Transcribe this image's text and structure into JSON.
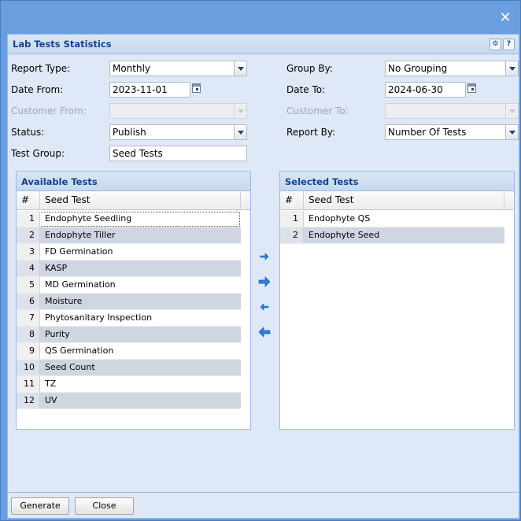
{
  "window": {
    "close_symbol": "✕"
  },
  "dialog": {
    "title": "Lab Tests Statistics",
    "tools": {
      "gear_symbol": "⚙",
      "help_symbol": "?"
    }
  },
  "form": {
    "report_type": {
      "label": "Report Type:",
      "value": "Monthly"
    },
    "group_by": {
      "label": "Group By:",
      "value": "No Grouping"
    },
    "date_from": {
      "label": "Date From:",
      "value": "2023-11-01"
    },
    "date_to": {
      "label": "Date To:",
      "value": "2024-06-30"
    },
    "customer_from": {
      "label": "Customer From:",
      "value": ""
    },
    "customer_to": {
      "label": "Customer To:",
      "value": ""
    },
    "status": {
      "label": "Status:",
      "value": "Publish"
    },
    "report_by": {
      "label": "Report By:",
      "value": "Number Of Tests"
    },
    "test_group": {
      "label": "Test Group:",
      "value": "Seed Tests"
    }
  },
  "available_tests": {
    "title": "Available Tests",
    "columns": [
      "#",
      "Seed Test"
    ],
    "rows": [
      {
        "n": "1",
        "name": "Endophyte Seedling"
      },
      {
        "n": "2",
        "name": "Endophyte Tiller"
      },
      {
        "n": "3",
        "name": "FD Germination"
      },
      {
        "n": "4",
        "name": "KASP"
      },
      {
        "n": "5",
        "name": "MD Germination"
      },
      {
        "n": "6",
        "name": "Moisture"
      },
      {
        "n": "7",
        "name": "Phytosanitary Inspection"
      },
      {
        "n": "8",
        "name": "Purity"
      },
      {
        "n": "9",
        "name": "QS Germination"
      },
      {
        "n": "10",
        "name": "Seed Count"
      },
      {
        "n": "11",
        "name": "TZ"
      },
      {
        "n": "12",
        "name": "UV"
      }
    ]
  },
  "selected_tests": {
    "title": "Selected Tests",
    "columns": [
      "#",
      "Seed Test"
    ],
    "rows": [
      {
        "n": "1",
        "name": "Endophyte QS"
      },
      {
        "n": "2",
        "name": "Endophyte Seed"
      }
    ]
  },
  "footer": {
    "generate_label": "Generate",
    "close_label": "Close"
  },
  "colors": {
    "accent": "#15428b",
    "panel_border": "#99bbe8",
    "alt_row": "#cfd6e2",
    "arrow_blue": "#2f7fd8"
  }
}
